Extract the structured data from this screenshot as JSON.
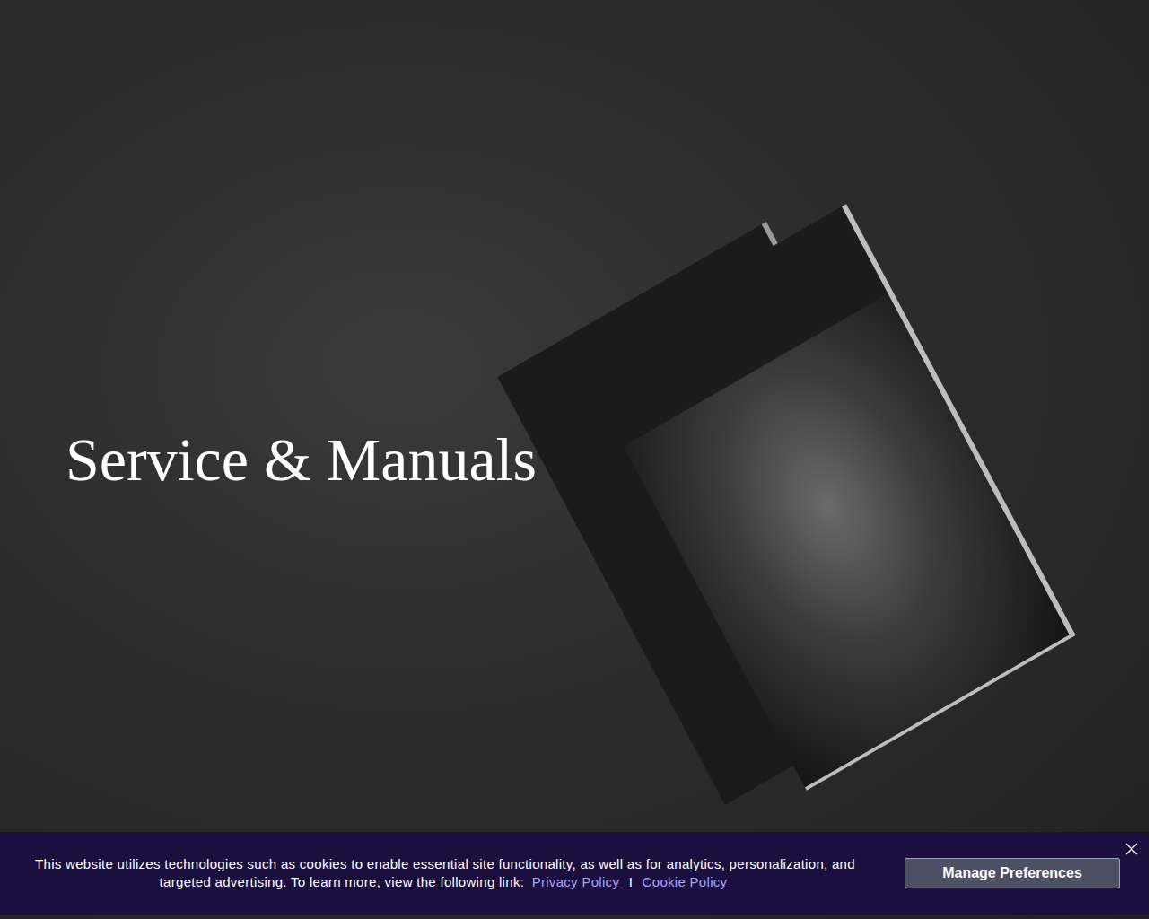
{
  "hero": {
    "title": "Service & Manuals"
  },
  "cookie_banner": {
    "message": "This website utilizes technologies such as cookies to enable essential site functionality, as well as for analytics, personalization, and targeted advertising. To learn more, view the following link:",
    "links": [
      {
        "label": "Privacy Policy"
      },
      {
        "label": "Cookie Policy"
      }
    ],
    "separator": "I",
    "button": "Manage Preferences"
  }
}
